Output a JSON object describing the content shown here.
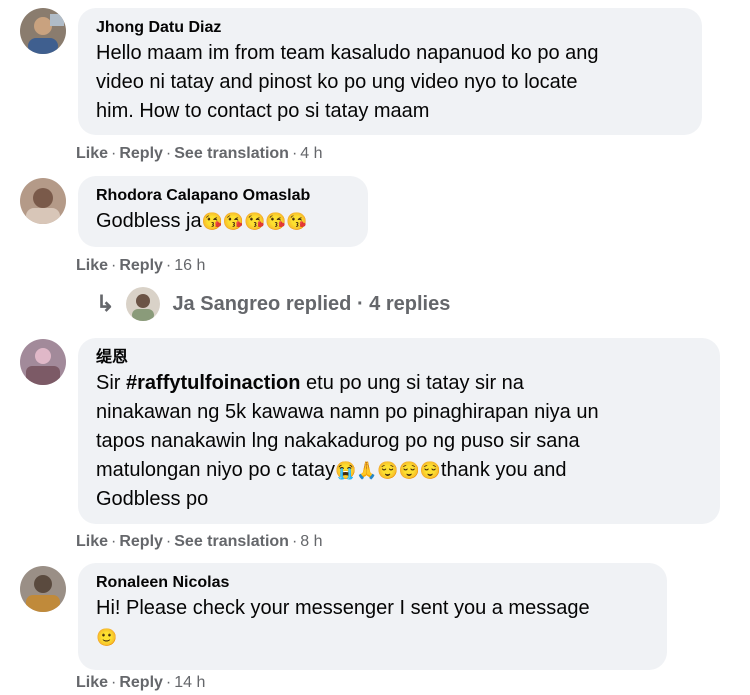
{
  "comments": [
    {
      "author": "Jhong Datu Diaz",
      "lines": [
        "Hello maam im from team kasaludo napanuod ko po ang",
        "video ni tatay and pinost ko po ung video nyo to locate",
        "him. How to contact po si tatay maam"
      ],
      "actions": {
        "like": "Like",
        "reply": "Reply",
        "translate": "See translation",
        "time": "4 h"
      }
    },
    {
      "author": "Rhodora Calapano Omaslab",
      "text": "Godbless ja",
      "emojis": "😘😘😘😘😘",
      "actions": {
        "like": "Like",
        "reply": "Reply",
        "time": "16 h"
      }
    },
    {
      "author": "缇恩",
      "line1_prefix": "Sir ",
      "hashtag": "#raffytulfoinaction",
      "line1_suffix": " etu po ung si tatay sir na",
      "line2": "ninakawan ng 5k kawawa namn po pinaghirapan niya un",
      "line3": "tapos nanakawin lng nakakadurog po ng puso sir sana",
      "line4_prefix": "matulongan niyo po c tatay",
      "line4_emojis": "😭🙏😌😌😌",
      "line4_suffix": "thank you and",
      "line5": "Godbless po",
      "actions": {
        "like": "Like",
        "reply": "Reply",
        "translate": "See translation",
        "time": "8 h"
      }
    },
    {
      "author": "Ronaleen Nicolas",
      "line1": "Hi! Please check your messenger I sent you a message",
      "line2_emoji": "🙂",
      "actions": {
        "like": "Like",
        "reply": "Reply",
        "time": "14 h"
      }
    }
  ],
  "replies_row": {
    "arrow": "↳",
    "text": "Ja Sangreo replied · 4 replies"
  },
  "colors": {
    "bubble": "#f0f2f5",
    "meta": "#65676b",
    "text": "#050505"
  }
}
